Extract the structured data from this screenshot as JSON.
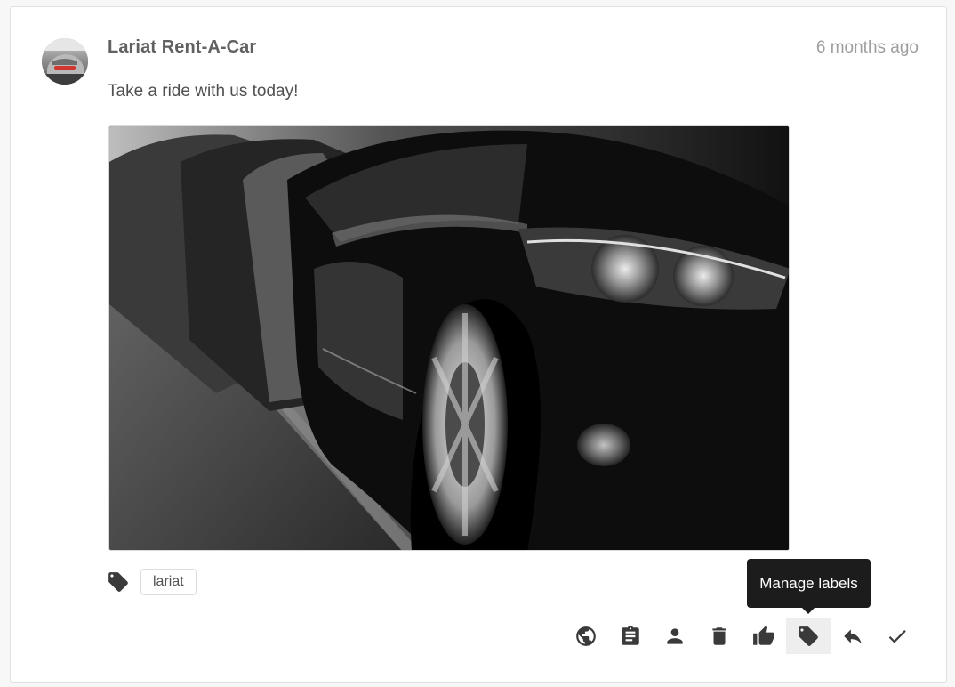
{
  "post": {
    "author": "Lariat Rent-A-Car",
    "timestamp": "6 months ago",
    "message": "Take a ride with us today!",
    "labels": [
      "lariat"
    ]
  },
  "tooltip": {
    "text": "Manage labels"
  },
  "actions": [
    {
      "icon": "globe-icon"
    },
    {
      "icon": "clipboard-icon"
    },
    {
      "icon": "person-icon"
    },
    {
      "icon": "trash-icon"
    },
    {
      "icon": "thumbs-up-icon"
    },
    {
      "icon": "tag-icon",
      "active": true
    },
    {
      "icon": "reply-icon"
    },
    {
      "icon": "check-icon"
    }
  ],
  "colors": {
    "author": "#616161",
    "timestamp": "#9e9e9e",
    "icon": "#3a3a3a",
    "tooltip_bg": "#1c1c1c"
  }
}
